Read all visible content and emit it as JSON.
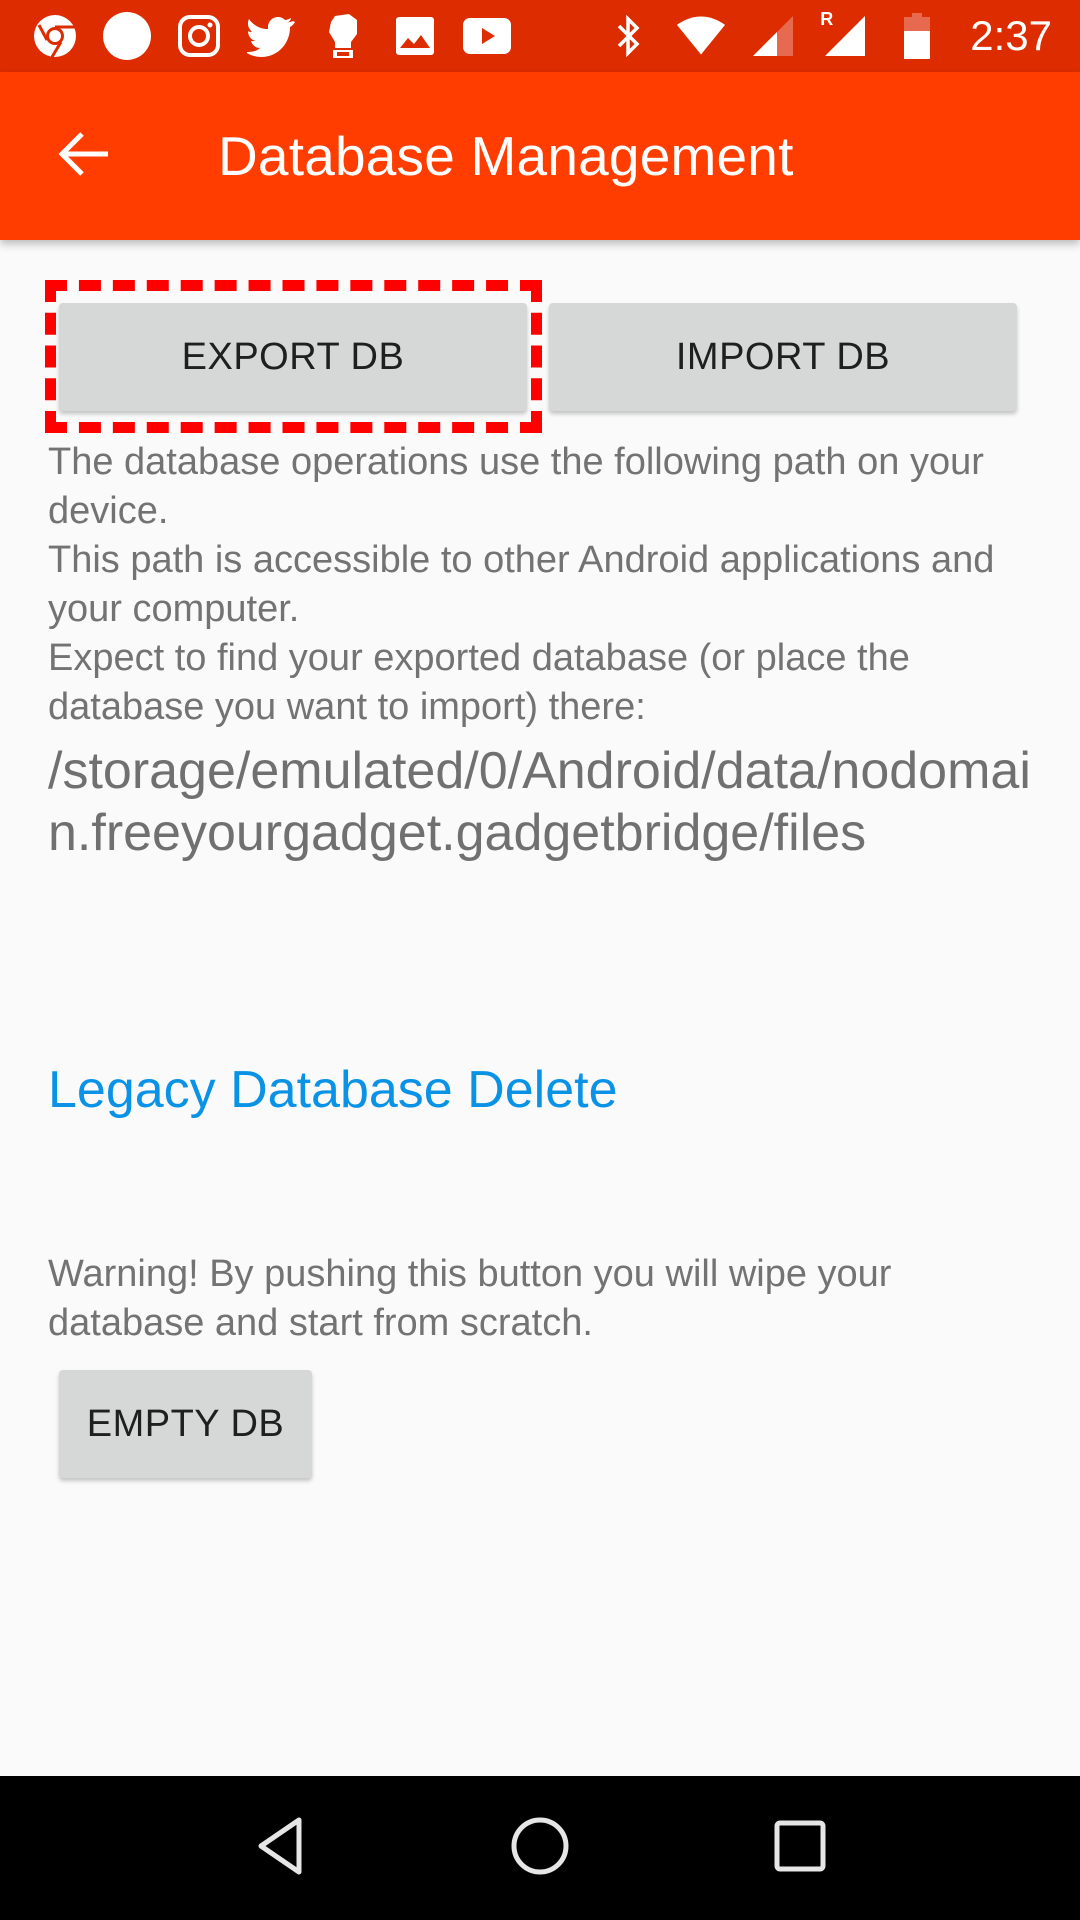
{
  "status_bar": {
    "notification_icons": [
      "chrome-icon",
      "circle-icon",
      "instagram-icon",
      "twitter-icon",
      "fist-icon",
      "gallery-icon",
      "youtube-icon"
    ],
    "system_icons": [
      "bluetooth-icon",
      "wifi-icon",
      "cell-signal-icon",
      "roaming-signal-icon",
      "battery-icon"
    ],
    "roaming_label": "R",
    "time": "2:37",
    "color": "#dd2c00"
  },
  "app_bar": {
    "title": "Database Management",
    "back_icon": "arrow-back-icon",
    "color": "#ff3d00"
  },
  "buttons": {
    "export": "EXPORT DB",
    "import": "IMPORT DB",
    "empty": "EMPTY DB"
  },
  "info": {
    "line1": "The database operations use the following path on your device.",
    "line2": "This path is accessible to other Android applications and your computer.",
    "line3": "Expect to find your exported database (or place the database you want to import) there:",
    "path": "/storage/emulated/0/Android/data/nodomain.freeyourgadget.gadgetbridge/files"
  },
  "legacy": {
    "label": "Legacy Database Delete",
    "color": "#0a93e6"
  },
  "warning": {
    "text": "Warning! By pushing this button you will wipe your database and start from scratch."
  },
  "highlight": {
    "target": "export-db-button",
    "color": "#ff0000"
  },
  "nav_bar": {
    "buttons": [
      "back",
      "home",
      "recents"
    ]
  }
}
